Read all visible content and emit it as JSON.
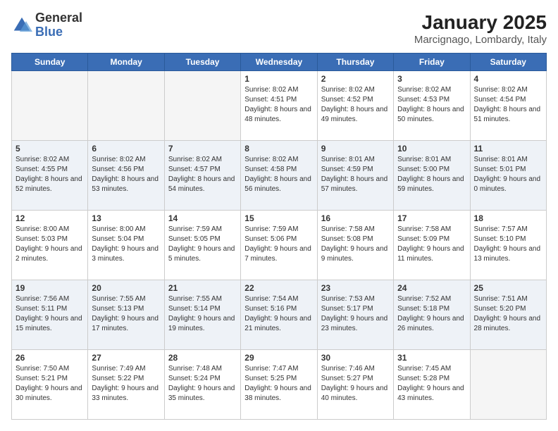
{
  "logo": {
    "general": "General",
    "blue": "Blue"
  },
  "header": {
    "month": "January 2025",
    "location": "Marcignago, Lombardy, Italy"
  },
  "weekdays": [
    "Sunday",
    "Monday",
    "Tuesday",
    "Wednesday",
    "Thursday",
    "Friday",
    "Saturday"
  ],
  "weeks": [
    [
      {
        "day": "",
        "empty": true
      },
      {
        "day": "",
        "empty": true
      },
      {
        "day": "",
        "empty": true
      },
      {
        "day": "1",
        "sunrise": "8:02 AM",
        "sunset": "4:51 PM",
        "daylight": "8 hours and 48 minutes"
      },
      {
        "day": "2",
        "sunrise": "8:02 AM",
        "sunset": "4:52 PM",
        "daylight": "8 hours and 49 minutes"
      },
      {
        "day": "3",
        "sunrise": "8:02 AM",
        "sunset": "4:53 PM",
        "daylight": "8 hours and 50 minutes"
      },
      {
        "day": "4",
        "sunrise": "8:02 AM",
        "sunset": "4:54 PM",
        "daylight": "8 hours and 51 minutes"
      }
    ],
    [
      {
        "day": "5",
        "sunrise": "8:02 AM",
        "sunset": "4:55 PM",
        "daylight": "8 hours and 52 minutes"
      },
      {
        "day": "6",
        "sunrise": "8:02 AM",
        "sunset": "4:56 PM",
        "daylight": "8 hours and 53 minutes"
      },
      {
        "day": "7",
        "sunrise": "8:02 AM",
        "sunset": "4:57 PM",
        "daylight": "8 hours and 54 minutes"
      },
      {
        "day": "8",
        "sunrise": "8:02 AM",
        "sunset": "4:58 PM",
        "daylight": "8 hours and 56 minutes"
      },
      {
        "day": "9",
        "sunrise": "8:01 AM",
        "sunset": "4:59 PM",
        "daylight": "8 hours and 57 minutes"
      },
      {
        "day": "10",
        "sunrise": "8:01 AM",
        "sunset": "5:00 PM",
        "daylight": "8 hours and 59 minutes"
      },
      {
        "day": "11",
        "sunrise": "8:01 AM",
        "sunset": "5:01 PM",
        "daylight": "9 hours and 0 minutes"
      }
    ],
    [
      {
        "day": "12",
        "sunrise": "8:00 AM",
        "sunset": "5:03 PM",
        "daylight": "9 hours and 2 minutes"
      },
      {
        "day": "13",
        "sunrise": "8:00 AM",
        "sunset": "5:04 PM",
        "daylight": "9 hours and 3 minutes"
      },
      {
        "day": "14",
        "sunrise": "7:59 AM",
        "sunset": "5:05 PM",
        "daylight": "9 hours and 5 minutes"
      },
      {
        "day": "15",
        "sunrise": "7:59 AM",
        "sunset": "5:06 PM",
        "daylight": "9 hours and 7 minutes"
      },
      {
        "day": "16",
        "sunrise": "7:58 AM",
        "sunset": "5:08 PM",
        "daylight": "9 hours and 9 minutes"
      },
      {
        "day": "17",
        "sunrise": "7:58 AM",
        "sunset": "5:09 PM",
        "daylight": "9 hours and 11 minutes"
      },
      {
        "day": "18",
        "sunrise": "7:57 AM",
        "sunset": "5:10 PM",
        "daylight": "9 hours and 13 minutes"
      }
    ],
    [
      {
        "day": "19",
        "sunrise": "7:56 AM",
        "sunset": "5:11 PM",
        "daylight": "9 hours and 15 minutes"
      },
      {
        "day": "20",
        "sunrise": "7:55 AM",
        "sunset": "5:13 PM",
        "daylight": "9 hours and 17 minutes"
      },
      {
        "day": "21",
        "sunrise": "7:55 AM",
        "sunset": "5:14 PM",
        "daylight": "9 hours and 19 minutes"
      },
      {
        "day": "22",
        "sunrise": "7:54 AM",
        "sunset": "5:16 PM",
        "daylight": "9 hours and 21 minutes"
      },
      {
        "day": "23",
        "sunrise": "7:53 AM",
        "sunset": "5:17 PM",
        "daylight": "9 hours and 23 minutes"
      },
      {
        "day": "24",
        "sunrise": "7:52 AM",
        "sunset": "5:18 PM",
        "daylight": "9 hours and 26 minutes"
      },
      {
        "day": "25",
        "sunrise": "7:51 AM",
        "sunset": "5:20 PM",
        "daylight": "9 hours and 28 minutes"
      }
    ],
    [
      {
        "day": "26",
        "sunrise": "7:50 AM",
        "sunset": "5:21 PM",
        "daylight": "9 hours and 30 minutes"
      },
      {
        "day": "27",
        "sunrise": "7:49 AM",
        "sunset": "5:22 PM",
        "daylight": "9 hours and 33 minutes"
      },
      {
        "day": "28",
        "sunrise": "7:48 AM",
        "sunset": "5:24 PM",
        "daylight": "9 hours and 35 minutes"
      },
      {
        "day": "29",
        "sunrise": "7:47 AM",
        "sunset": "5:25 PM",
        "daylight": "9 hours and 38 minutes"
      },
      {
        "day": "30",
        "sunrise": "7:46 AM",
        "sunset": "5:27 PM",
        "daylight": "9 hours and 40 minutes"
      },
      {
        "day": "31",
        "sunrise": "7:45 AM",
        "sunset": "5:28 PM",
        "daylight": "9 hours and 43 minutes"
      },
      {
        "day": "",
        "empty": true
      }
    ]
  ]
}
